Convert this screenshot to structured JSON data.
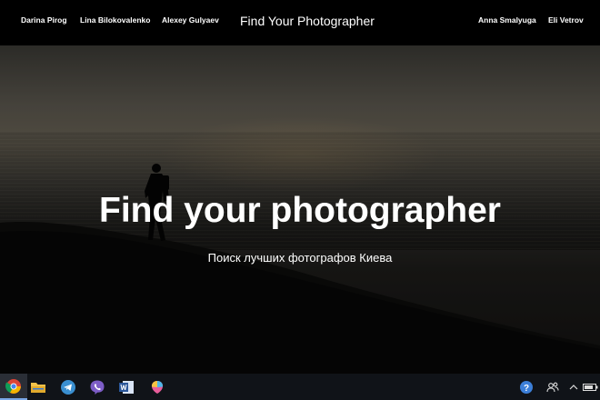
{
  "nav": {
    "left_links": [
      "Darina Pirog",
      "Lina Bilokovalenko",
      "Alexey Gulyaev"
    ],
    "brand": "Find Your Photographer",
    "right_links": [
      "Anna Smalyuga",
      "Eli Vetrov"
    ]
  },
  "hero": {
    "title": "Find your photographer",
    "subtitle": "Поиск лучших фотографов Киева"
  },
  "taskbar": {
    "apps": [
      "chrome-icon",
      "file-explorer-icon",
      "telegram-icon",
      "viber-icon",
      "word-icon",
      "paint-3d-icon"
    ],
    "tray": [
      "help-icon",
      "people-icon",
      "chevron-up-icon",
      "battery-icon"
    ],
    "accent": "#7aa7e6"
  }
}
